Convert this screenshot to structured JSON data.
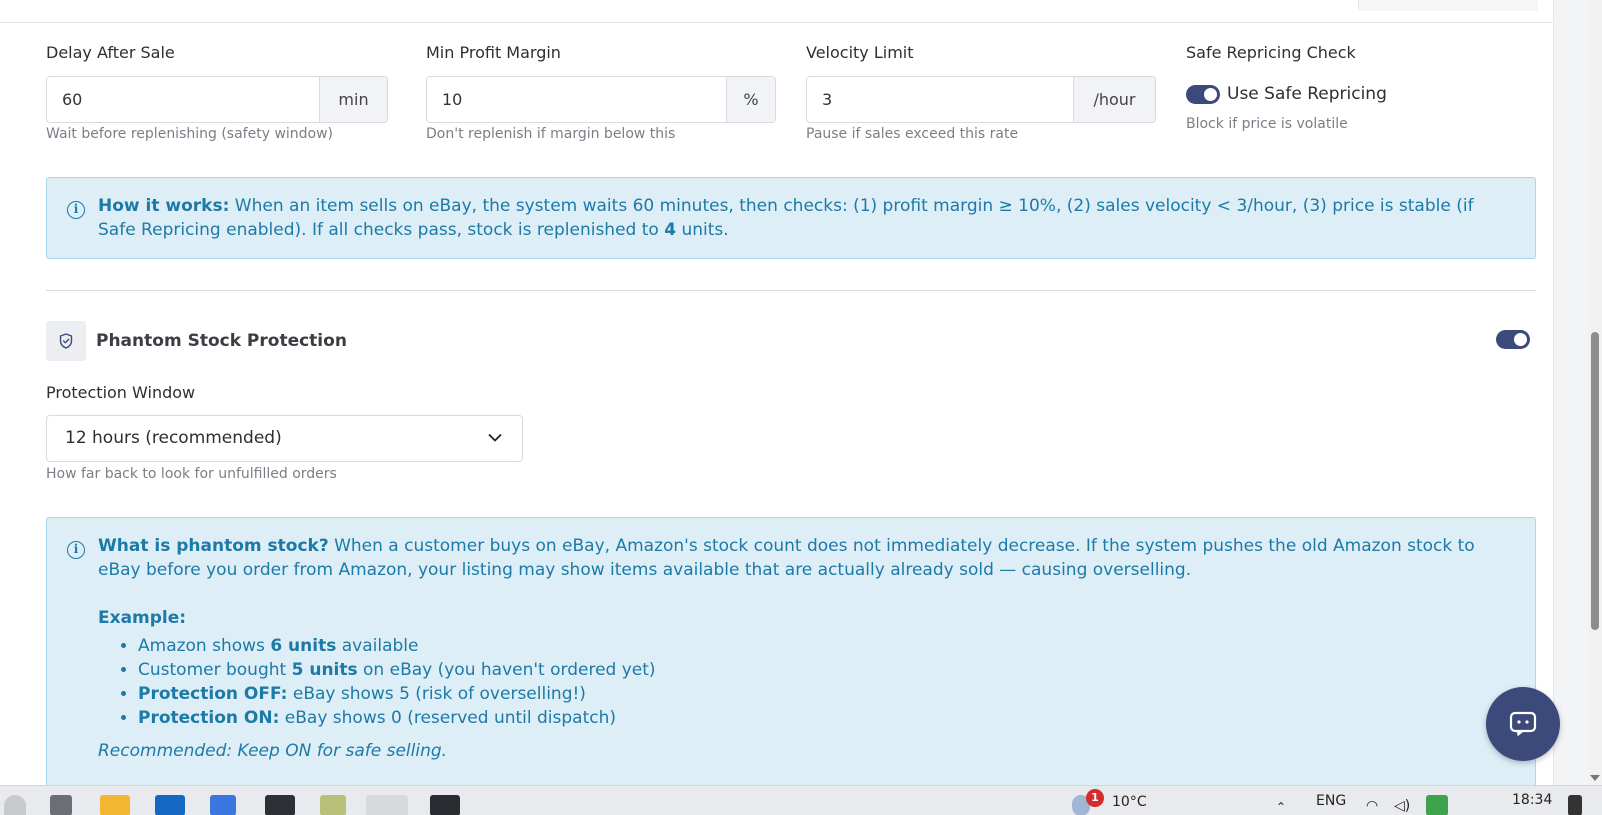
{
  "fields": {
    "delay": {
      "label": "Delay After Sale",
      "value": "60",
      "unit": "min",
      "help": "Wait before replenishing (safety window)"
    },
    "margin": {
      "label": "Min Profit Margin",
      "value": "10",
      "unit": "%",
      "help": "Don't replenish if margin below this"
    },
    "velocity": {
      "label": "Velocity Limit",
      "value": "3",
      "unit": "/hour",
      "help": "Pause if sales exceed this rate"
    },
    "safe": {
      "label": "Safe Repricing Check",
      "toggle_label": "Use Safe Repricing",
      "help": "Block if price is volatile",
      "enabled": true
    }
  },
  "how_it_works": {
    "heading": "How it works:",
    "text_a": " When an item sells on eBay, the system waits 60 minutes, then checks: (1) profit margin ≥ 10%, (2) sales velocity < 3/hour, (3) price is stable (if Safe Repricing enabled). If all checks pass, stock is replenished to ",
    "units": "4",
    "text_b": " units."
  },
  "phantom": {
    "title": "Phantom Stock Protection",
    "enabled": true,
    "window_label": "Protection Window",
    "window_value": "12 hours (recommended)",
    "window_help": "How far back to look for unfulfilled orders",
    "info": {
      "heading": "What is phantom stock?",
      "text": " When a customer buys on eBay, Amazon's stock count does not immediately decrease. If the system pushes the old Amazon stock to eBay before you order from Amazon, your listing may show items available that are actually already sold — causing overselling.",
      "example_label": "Example:",
      "items": [
        {
          "pre": "Amazon shows ",
          "bold": "6 units",
          "post": " available"
        },
        {
          "pre": "Customer bought ",
          "bold": "5 units",
          "post": " on eBay (you haven't ordered yet)"
        },
        {
          "pre": "",
          "bold": "Protection OFF:",
          "post": " eBay shows 5 (risk of overselling!)"
        },
        {
          "pre": "",
          "bold": "Protection ON:",
          "post": " eBay shows 0 (reserved until dispatch)"
        }
      ],
      "recommendation": "Recommended: Keep ON for safe selling."
    }
  },
  "taskbar": {
    "weather_badge": "1",
    "temperature": "10°C",
    "language": "ENG",
    "time": "18:34"
  },
  "colors": {
    "accent": "#3b4a7a",
    "info_bg": "#ddeef7",
    "info_text": "#1d7aa7"
  }
}
